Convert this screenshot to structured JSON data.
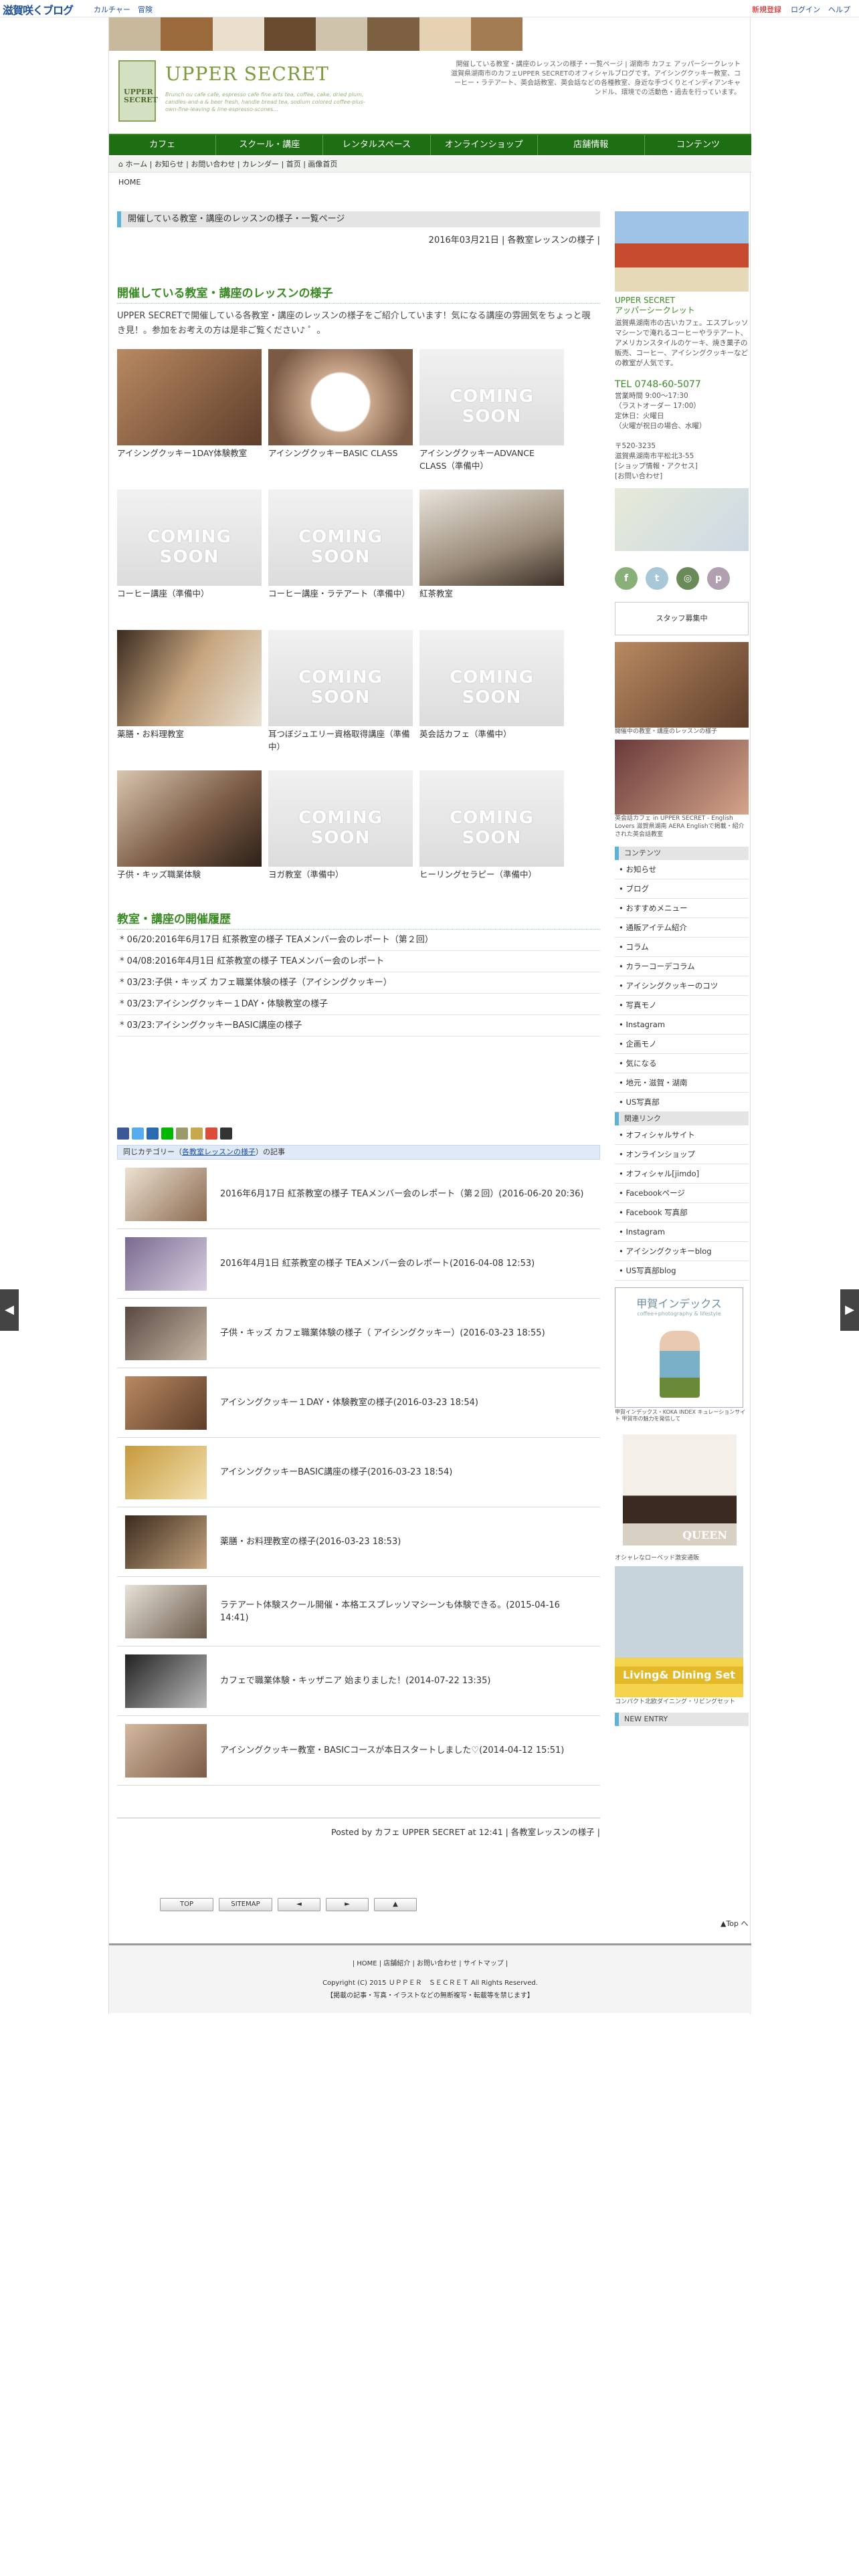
{
  "topbar": {
    "site_name": "滋賀咲くブログ",
    "left_links": [
      "カルチャー",
      "冒険"
    ],
    "right_links": [
      "新規登録",
      "ログイン",
      "ヘルプ"
    ]
  },
  "header": {
    "desc": "開催している教室・講座のレッスンの様子・一覧ページ | 湖南市 カフェ アッパーシークレット 滋賀県湖南市のカフェUPPER SECRETのオフィシャルブログです。アイシングクッキー教室、コーヒー・ラテアート、英会話教室、英会話などの各種教室、身近な手づくりとインディアンキャンドル、環境での活動色・過去を行っています。",
    "logo_box": "UPPER SECRET",
    "logo_title": "UPPER SECRET",
    "logo_sub": "Brunch ou cafe cafe, espresso cafe fine arts tea, coffee, cake, dried plum, candles-and-a & beer fresh, handle bread tea, sodium colored coffee-plus-own-fine-leaving & line-espresso-scones..."
  },
  "gnav": [
    "カフェ",
    "スクール・講座",
    "レンタルスペース",
    "オンラインショップ",
    "店舗情報",
    "コンテンツ"
  ],
  "breadcrumb": "ホーム | お知らせ | お問い合わせ | カレンダー | 首页 | 画像首页",
  "breadcrumb2": "HOME",
  "main": {
    "list_heading": "開催している教室・講座のレッスンの様子・一覧ページ",
    "date_line": "2016年03月21日 | 各教室レッスンの様子 |",
    "article_title": "開催している教室・講座のレッスンの様子",
    "intro": "UPPER SECRETで開催している各教室・講座のレッスンの様子をご紹介しています！気になる講座の雰囲気をちょっと覗き見！。参加をお考えの方は是非ご覧ください♪ ゜。",
    "classes": [
      {
        "label": "アイシングクッキー1DAY体験教室",
        "soon": false
      },
      {
        "label": "アイシングクッキーBASIC CLASS",
        "soon": false
      },
      {
        "label": "アイシングクッキーADVANCE CLASS（準備中）",
        "soon": true
      },
      {
        "label": "コーヒー講座（準備中）",
        "soon": true
      },
      {
        "label": "コーヒー講座・ラテアート（準備中）",
        "soon": true
      },
      {
        "label": "紅茶教室",
        "soon": false
      },
      {
        "label": "薬膳・お料理教室",
        "soon": false
      },
      {
        "label": "耳つぼジュエリー資格取得講座（準備中）",
        "soon": true
      },
      {
        "label": "英会話カフェ（準備中）",
        "soon": true
      },
      {
        "label": "子供・キッズ職業体験",
        "soon": false
      },
      {
        "label": "ヨガ教室（準備中）",
        "soon": true
      },
      {
        "label": "ヒーリングセラピー（準備中）",
        "soon": true
      }
    ],
    "history_title": "教室・講座の開催履歴",
    "history": [
      "06/20:2016年6月17日 紅茶教室の様子 TEAメンバー会のレポート（第２回）",
      "04/08:2016年4月1日 紅茶教室の様子 TEAメンバー会のレポート",
      "03/23:子供・キッズ カフェ職業体験の様子（アイシングクッキー）",
      "03/23:アイシングクッキー１DAY・体験教室の様子",
      "03/23:アイシングクッキーBASIC講座の様子"
    ],
    "related_heading_pre": "同じカテゴリー（",
    "related_heading_cat": "各教室レッスンの様子",
    "related_heading_post": "）の記事",
    "related": [
      "2016年6月17日 紅茶教室の様子 TEAメンバー会のレポート（第２回）(2016-06-20 20:36)",
      "2016年4月1日 紅茶教室の様子 TEAメンバー会のレポート(2016-04-08 12:53)",
      "子供・キッズ カフェ職業体験の様子（ アイシングクッキー）(2016-03-23 18:55)",
      "アイシングクッキー１DAY・体験教室の様子(2016-03-23 18:54)",
      "アイシングクッキーBASIC講座の様子(2016-03-23 18:54)",
      "薬膳・お料理教室の様子(2016-03-23 18:53)",
      "ラテアート体験スクール開催・本格エスプレッソマシーンも体験できる。(2015-04-16 14:41)",
      "カフェで職業体験・キッザニア 始まりました！(2014-07-22 13:35)",
      "アイシングクッキー教室・BASICコースが本日スタートしました♡(2014-04-12 15:51)"
    ],
    "posted": "Posted by カフェ UPPER SECRET at 12:41 | 各教室レッスンの様子 |"
  },
  "pager": [
    "TOP",
    "SITEMAP",
    "◄",
    "►",
    "▲"
  ],
  "top_link": "▲Top へ",
  "footer": {
    "links": "| HOME | 店舗紹介 | お問い合わせ | サイトマップ |",
    "copyright": "Copyright (C) 2015 ＵＰＰＥＲ　ＳＥＣＲＥＴ All Rights Reserved.",
    "notice": "【掲載の記事・写真・イラストなどの無断複写・転載等を禁じます】"
  },
  "sidebar": {
    "brand": "UPPER SECRET\nアッパーシークレット",
    "brand_desc": "滋賀県湖南市の古いカフェ。エスプレッソマシーンで淹れるコーヒーやラテアート、アメリカンスタイルのケーキ、焼き菓子の販売、コーヒー、アイシングクッキーなどの教室が人気です。",
    "tel": "TEL 0748-60-5077",
    "hours": "営業時間 9:00〜17:30\n（ラストオーダー 17:00）\n定休日：火曜日\n（火曜が祝日の場合、水曜）\n\n〒520-3235\n滋賀県湖南市平松北3-55\n[ショップ情報・アクセス]\n[お問い合わせ]",
    "staff": "スタッフ募集中",
    "img_caption1": "開催中の教室・講座のレッスンの様子",
    "img_caption2": "英会話カフェ in UPPER SECRET - English Lovers 滋賀県湖南 AERA Englishで掲載・紹介された英会話教室",
    "contents_h": "コンテンツ",
    "contents": [
      "お知らせ",
      "ブログ",
      "おすすめメニュー",
      "通販アイテム紹介",
      "コラム",
      "カラーコーデコラム",
      "アイシングクッキーのコツ",
      "写真モノ",
      "Instagram",
      "企画モノ",
      "気になる",
      "地元・滋賀・湖南",
      "US写真部"
    ],
    "links_h": "関連リンク",
    "links": [
      "オフィシャルサイト",
      "オンラインショップ",
      "オフィシャル[jimdo]",
      "Facebookページ",
      "Facebook 写真部",
      "Instagram",
      "アイシングクッキーblog",
      "US写真部blog"
    ],
    "ad1_title": "甲賀インデックス",
    "ad1_sub": "coffee+photography & lifestyle",
    "ad1_caption": "甲賀インデックス・KOKA INDEX キュレーションサイト 甲賀市の魅力を発信して",
    "ad2_title": "QUEEN",
    "ad2_caption": "オシャレなローベッド激安通販",
    "ad3_title": "Living& Dining Set",
    "ad3_caption": "コンパクト北欧ダイニング・リビングセット",
    "new_entry_h": "NEW ENTRY"
  },
  "colors": {
    "nav_green": "#1e6e14",
    "heading_green": "#3a8a24",
    "accent_blue": "#5bb3d9"
  }
}
